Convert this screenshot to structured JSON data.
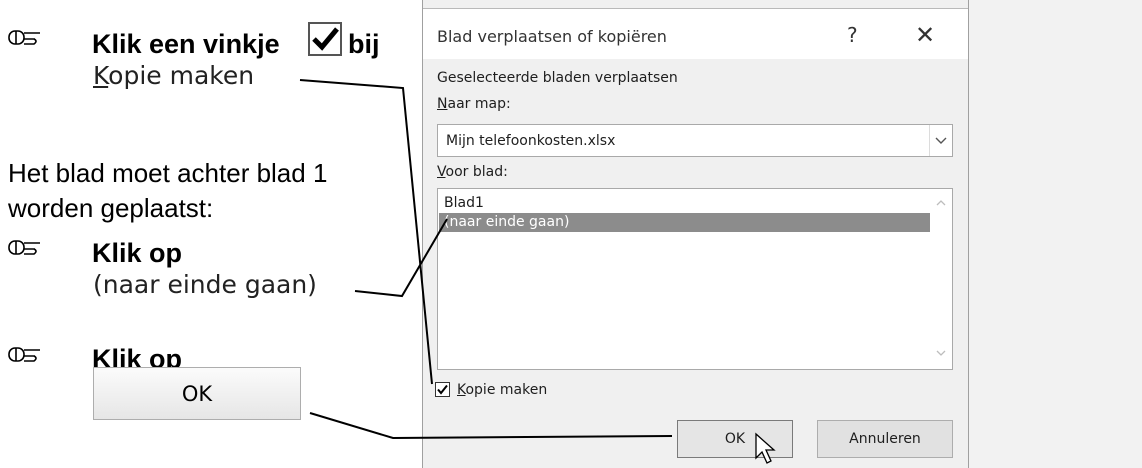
{
  "left": {
    "step1_pre": "Klik een vinkje",
    "step1_post": "bij",
    "step1_target_accel": "K",
    "step1_target_rest": "opie maken",
    "info_line1": "Het blad moet achter blad 1",
    "info_line2": "worden geplaatst:",
    "step2_label": "Klik op",
    "step2_target": "(naar einde gaan)",
    "step3_label": "Klik op",
    "step3_button": "OK",
    "hand_icon": "pointing-hand-icon"
  },
  "dialog": {
    "title": "Blad verplaatsen of kopiëren",
    "help": "?",
    "close": "✕",
    "section_label": "Geselecteerde bladen verplaatsen",
    "map_label_accel": "N",
    "map_label_rest": "aar map:",
    "map_value": "Mijn telefoonkosten.xlsx",
    "voor_label_accel": "V",
    "voor_label_rest": "oor blad:",
    "list_items": [
      "Blad1",
      "(naar einde gaan)"
    ],
    "selected_index": 1,
    "copy_accel": "K",
    "copy_rest": "opie maken",
    "copy_checked": true,
    "ok_label": "OK",
    "cancel_label": "Annuleren"
  }
}
